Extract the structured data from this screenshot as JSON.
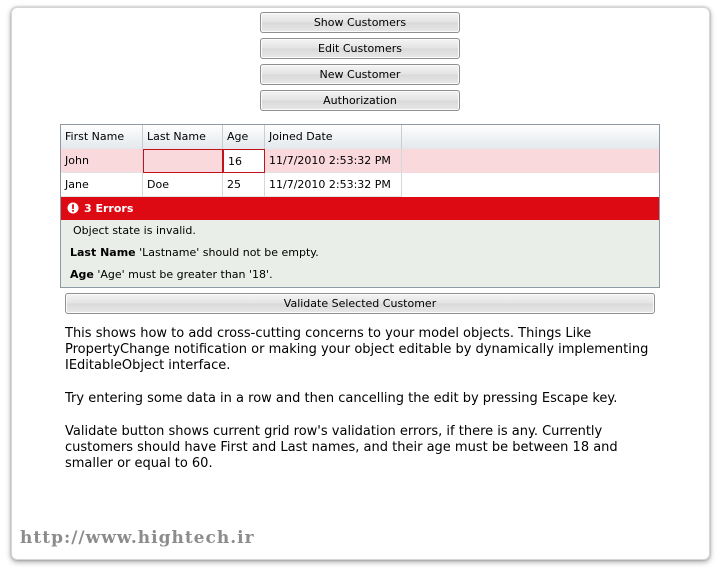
{
  "buttons": {
    "show_customers": "Show Customers",
    "edit_customers": "Edit Customers",
    "new_customer": "New Customer",
    "authorization": "Authorization",
    "validate": "Validate Selected Customer"
  },
  "grid": {
    "columns": [
      "First Name",
      "Last Name",
      "Age",
      "Joined Date"
    ],
    "rows": [
      {
        "first": "John",
        "last": "",
        "age": "16",
        "joined": "11/7/2010 2:53:32 PM"
      },
      {
        "first": "Jane",
        "last": "Doe",
        "age": "25",
        "joined": "11/7/2010 2:53:32 PM"
      }
    ]
  },
  "errors": {
    "header": "3 Errors",
    "icon": "exclamation-circle-icon",
    "object_state": "Object state is invalid.",
    "last_name_field": "Last Name",
    "last_name_msg": "'Lastname' should not be empty.",
    "age_field": "Age",
    "age_msg": "'Age' must be greater than '18'."
  },
  "description": {
    "p1": "This shows how to add cross-cutting concerns to your model objects. Things Like PropertyChange notification or making your object editable by dynamically implementing IEditableObject interface.",
    "p2": "Try entering some data in a row and then cancelling the edit by pressing Escape key.",
    "p3": "Validate button shows current grid row's validation errors, if there is any. Currently customers should have First and Last names, and their age must be between 18 and smaller or equal to 60."
  },
  "watermark": "http://www.hightech.ir",
  "colors": {
    "error_red": "#dd0a14",
    "invalid_row": "#f9d9dc",
    "error_panel": "#eaeee8"
  }
}
